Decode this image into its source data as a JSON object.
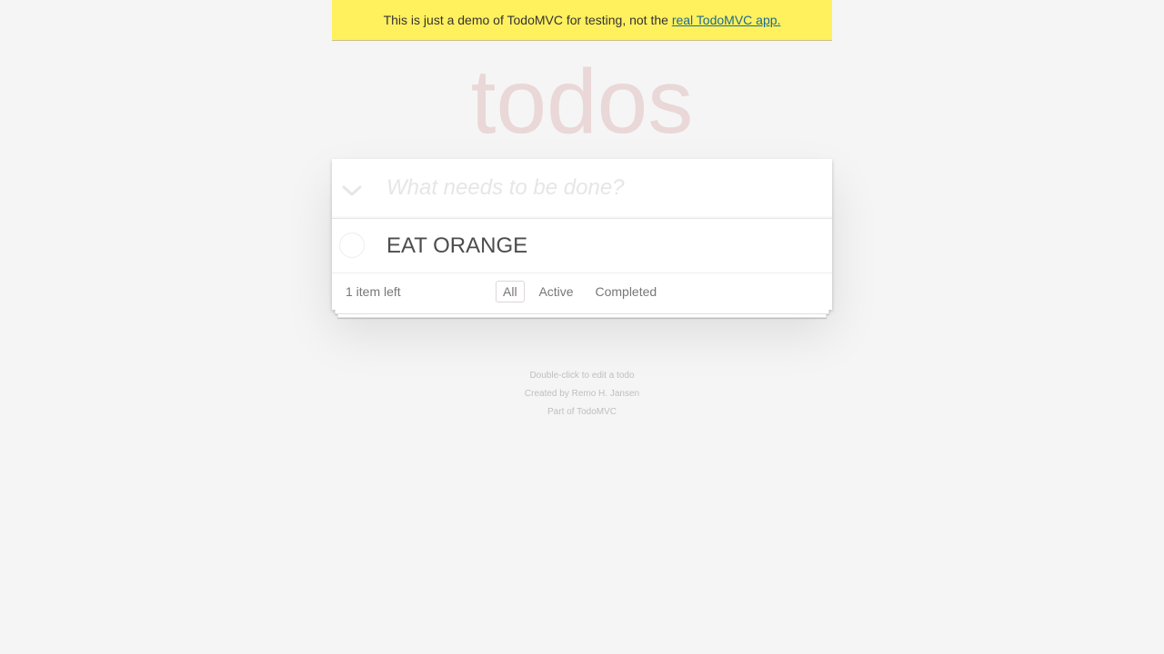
{
  "banner": {
    "text": "This is just a demo of TodoMVC for testing, not the ",
    "link_text": "real TodoMVC app."
  },
  "app": {
    "title": "todos"
  },
  "new_todo": {
    "placeholder": "What needs to be done?",
    "value": ""
  },
  "todos": [
    {
      "label": "EAT ORANGE",
      "completed": false
    }
  ],
  "footer": {
    "count_text": "1 item left",
    "filters": [
      {
        "label": "All",
        "selected": true
      },
      {
        "label": "Active",
        "selected": false
      },
      {
        "label": "Completed",
        "selected": false
      }
    ]
  },
  "info": {
    "line1": "Double-click to edit a todo",
    "line2": "Created by Remo H. Jansen",
    "line3": "Part of TodoMVC"
  },
  "icons": {
    "toggle_all": "chevron-down-icon",
    "todo_toggle": "circle-checkbox-icon"
  },
  "colors": {
    "banner_bg": "#fff05e",
    "title": "#e8d6d6",
    "link": "#1c6b8f"
  }
}
